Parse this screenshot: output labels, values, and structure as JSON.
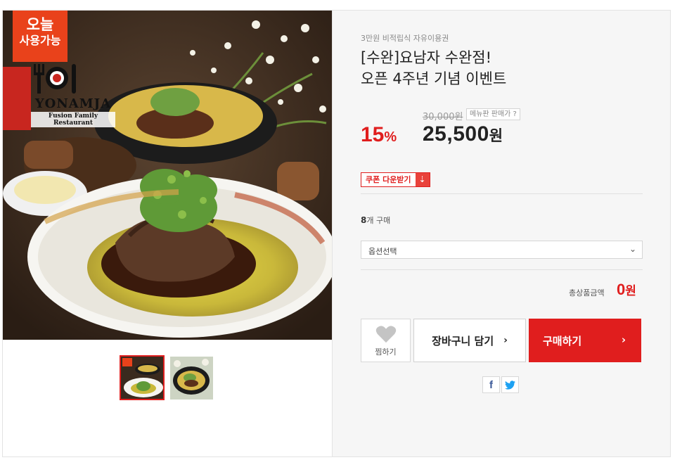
{
  "badge": {
    "line1": "오늘",
    "line2": "사용가능"
  },
  "logo": {
    "name": "YONAMJA",
    "tagline": "Fusion Family Restaurant"
  },
  "product": {
    "category": "3만원 비적립식 자유이용권",
    "title_line1": "[수완]요남자 수완점!",
    "title_line2": "오픈 4주년 기념 이벤트",
    "original_price": "30,000원",
    "menu_price_label": "메뉴판 판매가 ?",
    "discount_value": "15",
    "discount_unit": "%",
    "sale_price_value": "25,500",
    "sale_price_unit": "원"
  },
  "coupon": {
    "label": "쿠폰 다운받기",
    "icon": "download-icon"
  },
  "purchase": {
    "count": "8",
    "count_suffix": "개 구매"
  },
  "option": {
    "placeholder": "옵션선택",
    "icon": "chevron-down-icon"
  },
  "total": {
    "label": "총상품금액",
    "value": "0",
    "unit": "원"
  },
  "actions": {
    "wish_label": "찜하기",
    "cart_label": "장바구니 담기",
    "cart_arrow": "›",
    "buy_label": "구매하기",
    "buy_arrow": "›"
  },
  "share": {
    "facebook": "f",
    "twitter": "t"
  },
  "colors": {
    "accent": "#e01e1e",
    "badge": "#e9421b",
    "panel_bg": "#f6f6f6"
  }
}
